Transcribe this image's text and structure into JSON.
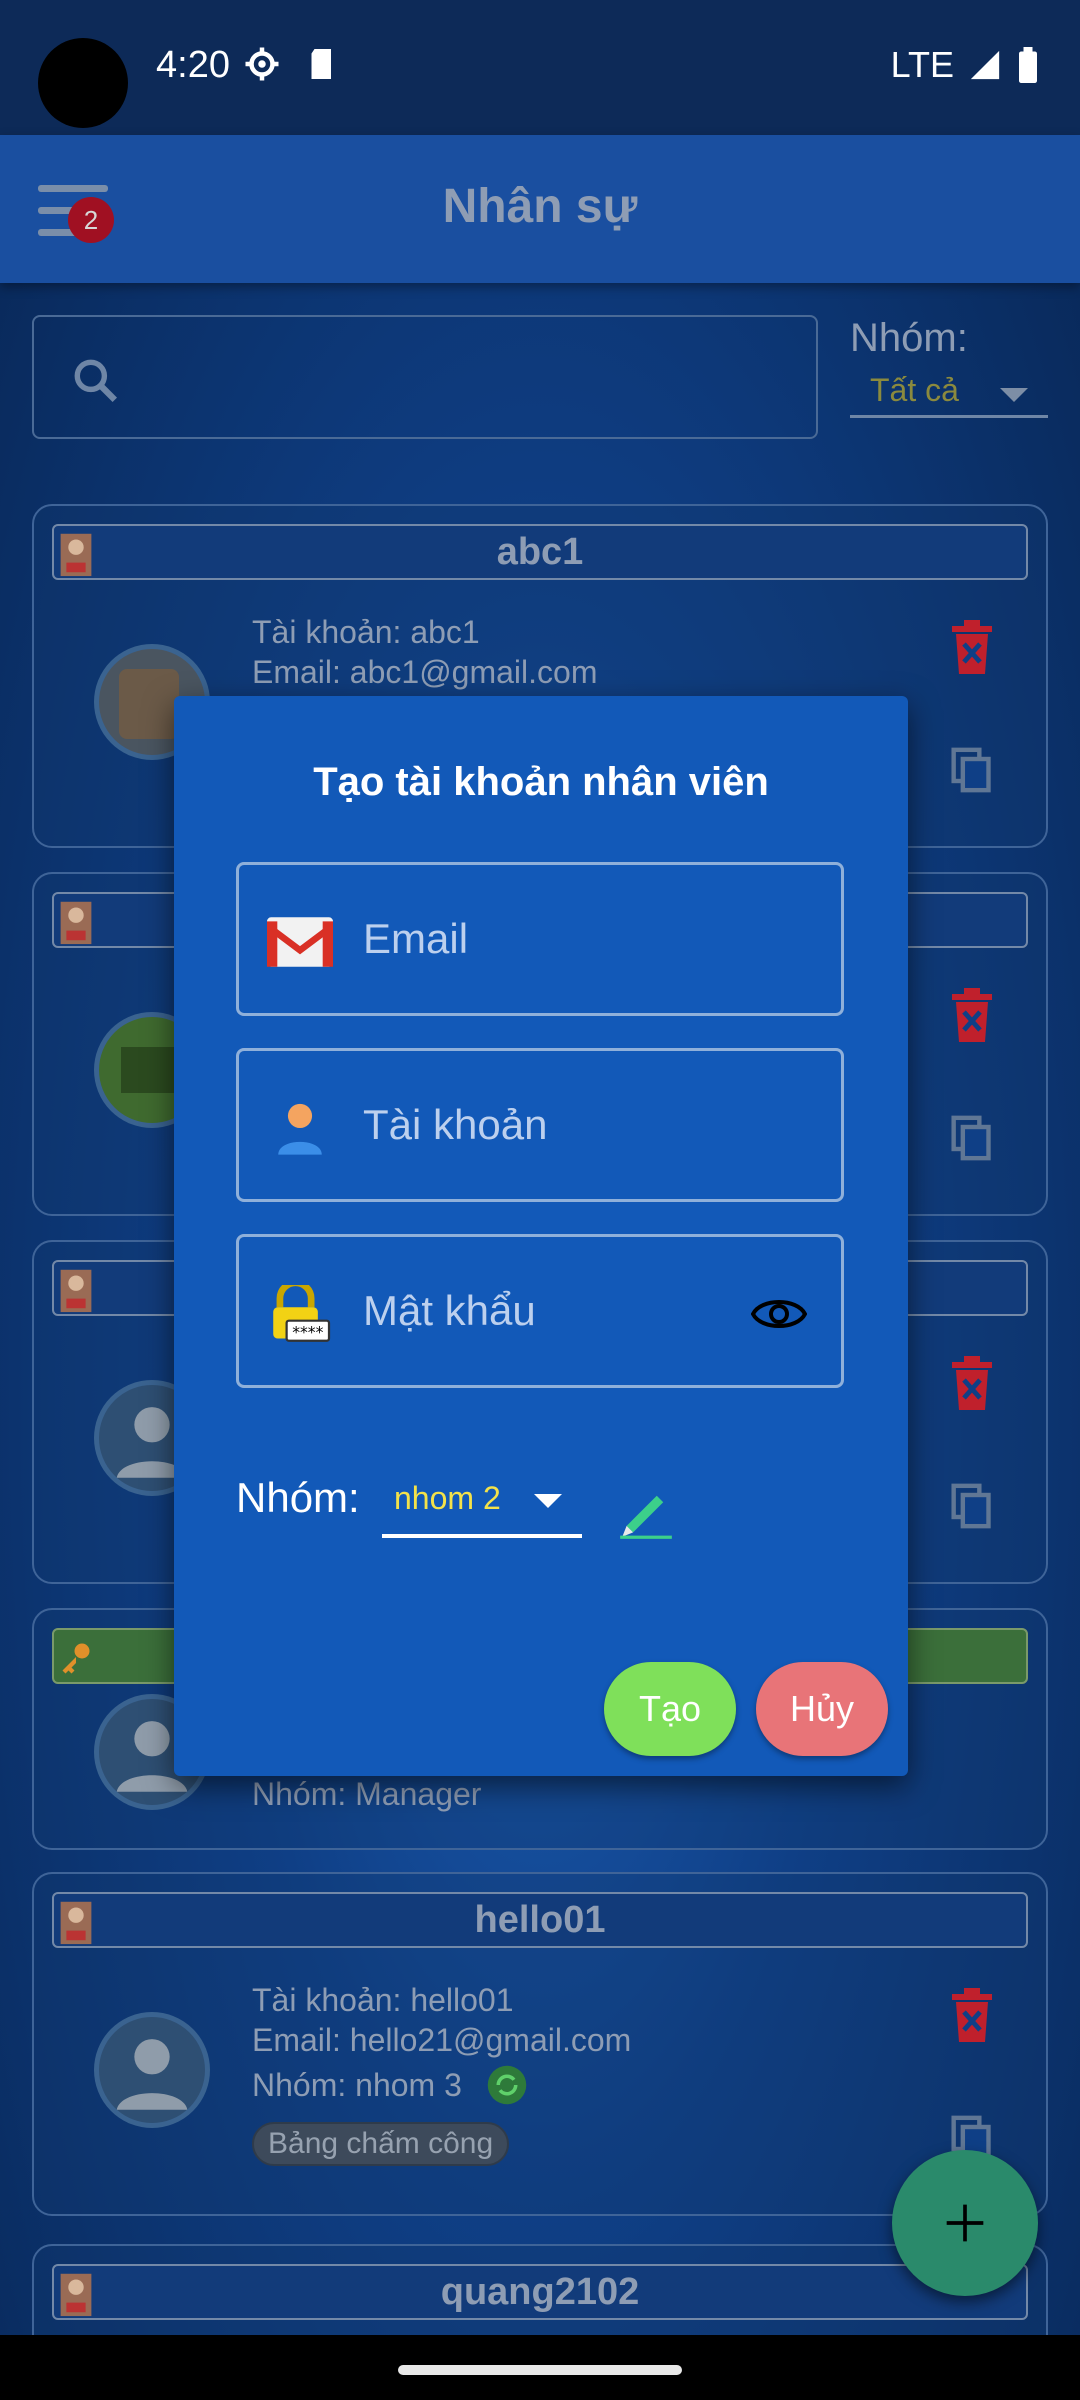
{
  "status_bar": {
    "time": "4:20",
    "network": "LTE"
  },
  "app_bar": {
    "title": "Nhân sự",
    "badge_count": "2"
  },
  "filter": {
    "group_label": "Nhóm:",
    "group_value": "Tất cả"
  },
  "cards": [
    {
      "name": "abc1",
      "account": "Tài khoản: abc1",
      "email": "Email: abc1@gmail.com"
    },
    {
      "name": "",
      "account": "",
      "email": ""
    },
    {
      "name": "",
      "account": "",
      "email": ""
    },
    {
      "name": "",
      "group": "Nhóm:  Manager"
    },
    {
      "name": "hello01",
      "account": "Tài khoản: hello01",
      "email": "Email: hello21@gmail.com",
      "group": "Nhóm:  nhom 3",
      "chip": "Bảng chấm công"
    },
    {
      "name": "quang2102"
    }
  ],
  "dialog": {
    "title": "Tạo tài khoản nhân viên",
    "email_placeholder": "Email",
    "account_placeholder": "Tài khoản",
    "password_placeholder": "Mật khẩu",
    "group_label": "Nhóm:",
    "group_value": "nhom 2",
    "create_label": "Tạo",
    "cancel_label": "Hủy"
  },
  "colors": {
    "dialog_bg": "#1259b8",
    "create": "#7fe05a",
    "cancel": "#e87478",
    "fab": "#2a8a6b"
  }
}
